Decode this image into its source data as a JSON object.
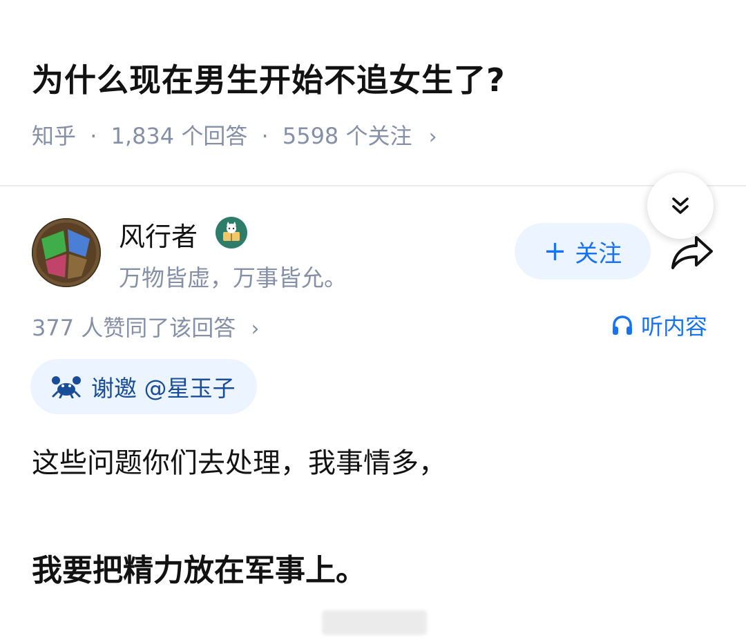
{
  "question": {
    "title": "为什么现在男生开始不追女生了?",
    "source": "知乎",
    "separator": "·",
    "answers_count": "1,834 个回答",
    "followers_count": "5598 个关注",
    "chevron": "›"
  },
  "collapse_button": {
    "icon": "double-chevron-down-icon"
  },
  "author": {
    "name": "风行者",
    "badge_icon": "reading-badge-icon",
    "bio": "万物皆虚，万事皆允。",
    "follow_label": "关注",
    "follow_plus": "+",
    "share_icon": "share-arrow-icon"
  },
  "answer_meta": {
    "likes_text": "377 人赞同了该回答",
    "chevron": "›",
    "listen_label": "听内容",
    "listen_icon": "headphones-icon"
  },
  "invite": {
    "label": "谢邀 @星玉子",
    "icon": "crab-icon"
  },
  "answer": {
    "line1": "这些问题你们去处理，我事情多，",
    "line2": "我要把精力放在军事上。"
  },
  "colors": {
    "accent": "#1772f6",
    "accent_bg": "#ebf4ff",
    "meta_gray": "#8590a6",
    "text": "#121212"
  }
}
